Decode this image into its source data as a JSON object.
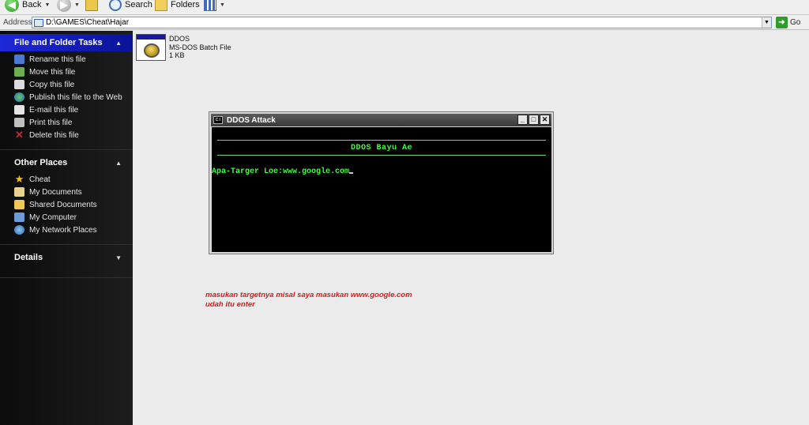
{
  "toolbar": {
    "back_label": "Back",
    "search_label": "Search",
    "folders_label": "Folders"
  },
  "addressbar": {
    "label": "Address",
    "path": "D:\\GAMES\\Cheat\\Hajar",
    "go_label": "Go"
  },
  "left_pane": {
    "file_tasks": {
      "title": "File and Folder Tasks",
      "items": [
        {
          "label": "Rename this file",
          "icon": "rename-icon"
        },
        {
          "label": "Move this file",
          "icon": "move-icon"
        },
        {
          "label": "Copy this file",
          "icon": "copy-icon"
        },
        {
          "label": "Publish this file to the Web",
          "icon": "globe-icon"
        },
        {
          "label": "E-mail this file",
          "icon": "email-icon"
        },
        {
          "label": "Print this file",
          "icon": "printer-icon"
        },
        {
          "label": "Delete this file",
          "icon": "delete-icon"
        }
      ]
    },
    "other_places": {
      "title": "Other Places",
      "items": [
        {
          "label": "Cheat",
          "icon": "folder-icon"
        },
        {
          "label": "My Documents",
          "icon": "documents-icon"
        },
        {
          "label": "Shared Documents",
          "icon": "shared-folder-icon"
        },
        {
          "label": "My Computer",
          "icon": "computer-icon"
        },
        {
          "label": "My Network Places",
          "icon": "network-icon"
        }
      ]
    },
    "details": {
      "title": "Details"
    }
  },
  "file": {
    "name": "DDOS",
    "type": "MS-DOS Batch File",
    "size": "1 KB"
  },
  "console": {
    "title": "DDOS Attack",
    "heading": "DDOS Bayu Ae",
    "prompt": "Apa-Targer Loe:www.google.com"
  },
  "caption": {
    "line1": "masukan targetnya misal saya masukan www.google.com",
    "line2": "udah itu enter"
  },
  "colors": {
    "console_text": "#3dff3d",
    "caption": "#e21818",
    "active_header": "#1d28d8"
  }
}
